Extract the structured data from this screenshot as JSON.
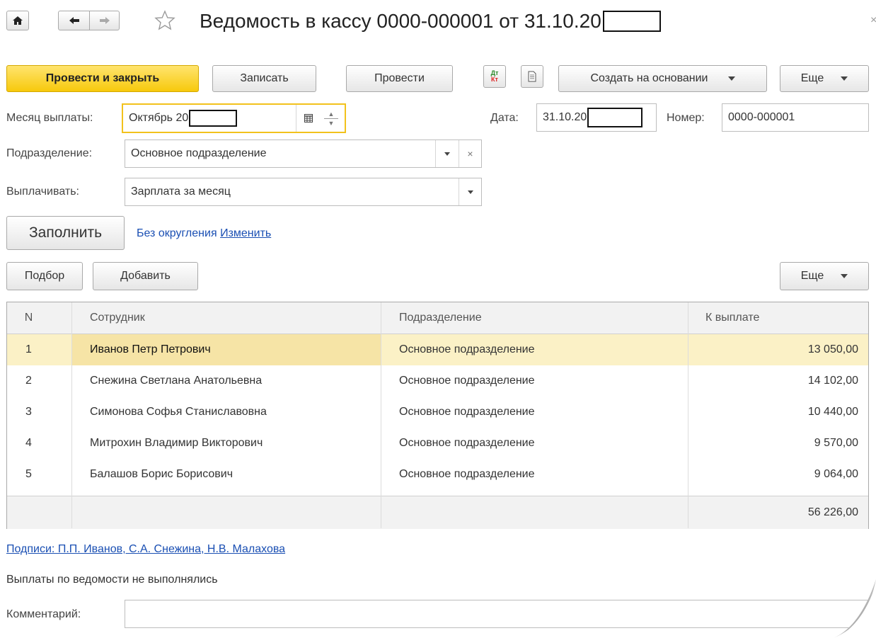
{
  "window": {
    "title": "Ведомость в кассу 0000-000001 от 31.10.20",
    "close_glyph": "×"
  },
  "toolbar": {
    "post_close": "Провести и закрыть",
    "save": "Записать",
    "post": "Провести",
    "dtkt_top": "Дт",
    "dtkt_bottom": "Кт",
    "create_based": "Создать на основании",
    "more": "Еще"
  },
  "form": {
    "month_label": "Месяц выплаты:",
    "month_value": "Октябрь 20",
    "date_label": "Дата:",
    "date_value": "31.10.20",
    "number_label": "Номер:",
    "number_value": "0000-000001",
    "division_label": "Подразделение:",
    "division_value": "Основное подразделение",
    "pay_label": "Выплачивать:",
    "pay_value": "Зарплата за месяц",
    "fill_button": "Заполнить",
    "rounding_text": "Без округления",
    "rounding_link": "Изменить"
  },
  "table_toolbar": {
    "pick": "Подбор",
    "add": "Добавить",
    "more": "Еще"
  },
  "table": {
    "headers": [
      "N",
      "Сотрудник",
      "Подразделение",
      "К выплате"
    ],
    "rows": [
      {
        "n": "1",
        "employee": "Иванов Петр Петрович",
        "division": "Основное подразделение",
        "amount": "13 050,00"
      },
      {
        "n": "2",
        "employee": "Снежина Светлана Анатольевна",
        "division": "Основное подразделение",
        "amount": "14 102,00"
      },
      {
        "n": "3",
        "employee": "Симонова Софья Станиславовна",
        "division": "Основное подразделение",
        "amount": "10 440,00"
      },
      {
        "n": "4",
        "employee": "Митрохин Владимир Викторович",
        "division": "Основное подразделение",
        "amount": "9 570,00"
      },
      {
        "n": "5",
        "employee": "Балашов Борис Борисович",
        "division": "Основное подразделение",
        "amount": "9 064,00"
      }
    ],
    "total": "56 226,00"
  },
  "footer": {
    "signatures_link": "Подписи: П.П. Иванов, С.А. Снежина, Н.В. Малахова",
    "status_text": "Выплаты по ведомости не выполнялись",
    "comment_label": "Комментарий:",
    "comment_value": ""
  },
  "colors": {
    "accent_yellow": "#f7c90c",
    "selected_row": "#fbf1c6",
    "selected_cell": "#f6e4a6",
    "link": "#1a4fb3"
  }
}
